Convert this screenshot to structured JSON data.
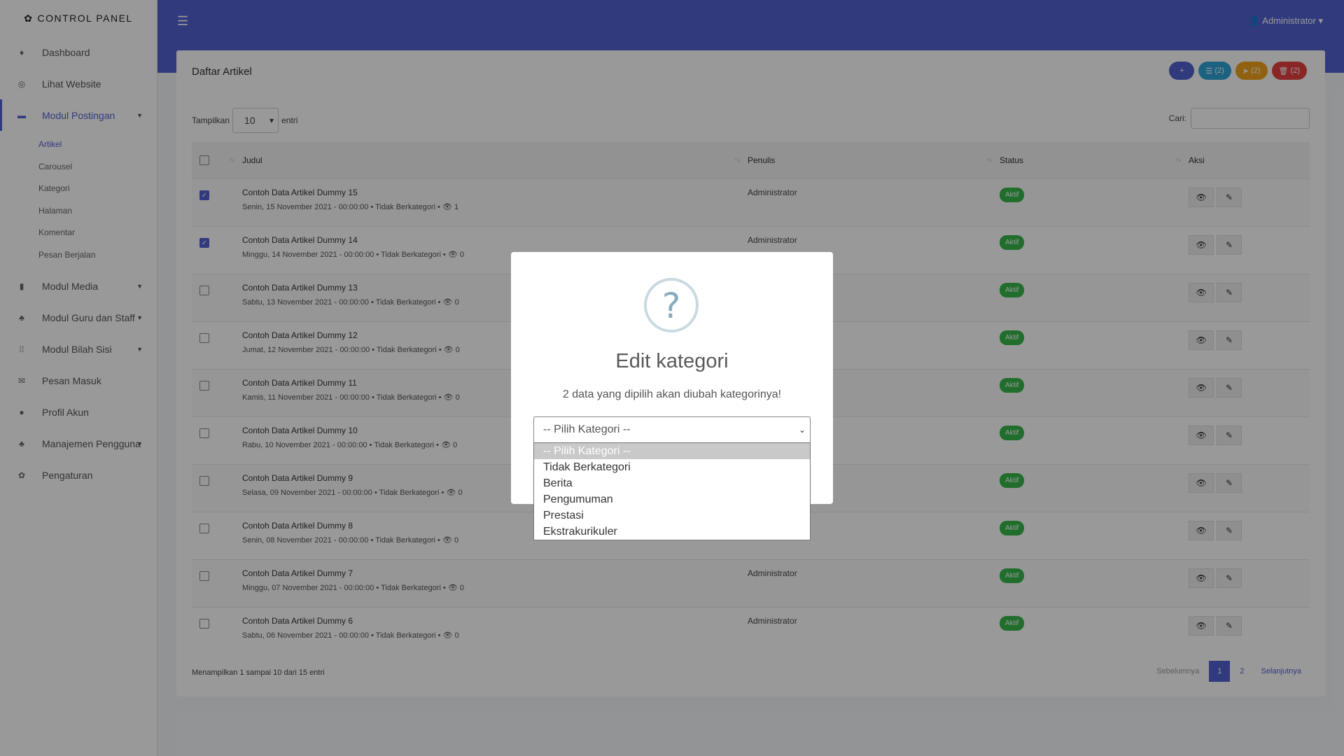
{
  "brand": {
    "icon": "gear-icon",
    "title": "CONTROL PANEL"
  },
  "colors": {
    "primary": "#5261d1",
    "success": "#36b64a",
    "info": "#2fa4d6",
    "warning": "#f0a21a",
    "danger": "#e54141"
  },
  "sidebar": {
    "items": [
      {
        "label": "Dashboard",
        "icon": "fire-icon"
      },
      {
        "label": "Lihat Website",
        "icon": "globe-icon"
      },
      {
        "label": "Modul Postingan",
        "icon": "card-icon"
      },
      {
        "label": "Modul Media",
        "icon": "book-icon"
      },
      {
        "label": "Modul Guru dan Staff",
        "icon": "users-icon"
      },
      {
        "label": "Modul Bilah Sisi",
        "icon": "grid-icon"
      },
      {
        "label": "Pesan Masuk",
        "icon": "mail-icon"
      },
      {
        "label": "Profil Akun",
        "icon": "user-icon"
      },
      {
        "label": "Manajemen Pengguna",
        "icon": "users-icon"
      },
      {
        "label": "Pengaturan",
        "icon": "gear-icon"
      }
    ],
    "submenu": [
      "Artikel",
      "Carousel",
      "Kategori",
      "Halaman",
      "Komentar",
      "Pesan Berjalan"
    ]
  },
  "header": {
    "user": "Administrator"
  },
  "card": {
    "title": "Daftar Artikel",
    "buttons": [
      "+",
      "(2)",
      "(2)",
      "(2)"
    ]
  },
  "length": {
    "prefix": "Tampilkan",
    "value": "10",
    "suffix": "entri"
  },
  "search": {
    "label": "Cari:"
  },
  "table": {
    "headers": [
      "Judul",
      "Penulis",
      "Status",
      "Aksi"
    ],
    "rows": [
      {
        "title": "Contoh Data Artikel Dummy 15",
        "meta": "Senin, 15 November 2021 - 00:00:00 •  Tidak Berkategori •",
        "views": "1",
        "author": "Administrator",
        "status": "Aktif"
      },
      {
        "title": "Contoh Data Artikel Dummy 14",
        "meta": "Minggu, 14 November 2021 - 00:00:00 •  Tidak Berkategori •",
        "views": "0",
        "author": "Administrator",
        "status": "Aktif"
      },
      {
        "title": "Contoh Data Artikel Dummy 13",
        "meta": "Sabtu, 13 November 2021 - 00:00:00 •  Tidak Berkategori •",
        "views": "0",
        "author": "",
        "status": "Aktif"
      },
      {
        "title": "Contoh Data Artikel Dummy 12",
        "meta": "Jumat, 12 November 2021 - 00:00:00 •  Tidak Berkategori •",
        "views": "0",
        "author": "",
        "status": "Aktif"
      },
      {
        "title": "Contoh Data Artikel Dummy 11",
        "meta": "Kamis, 11 November 2021 - 00:00:00 •  Tidak Berkategori •",
        "views": "0",
        "author": "",
        "status": "Aktif"
      },
      {
        "title": "Contoh Data Artikel Dummy 10",
        "meta": "Rabu, 10 November 2021 - 00:00:00 •  Tidak Berkategori •",
        "views": "0",
        "author": "",
        "status": "Aktif"
      },
      {
        "title": "Contoh Data Artikel Dummy 9",
        "meta": "Selasa, 09 November 2021 - 00:00:00 •  Tidak Berkategori •",
        "views": "0",
        "author": "",
        "status": "Aktif"
      },
      {
        "title": "Contoh Data Artikel Dummy 8",
        "meta": "Senin, 08 November 2021 - 00:00:00 •  Tidak Berkategori •",
        "views": "0",
        "author": "",
        "status": "Aktif"
      },
      {
        "title": "Contoh Data Artikel Dummy 7",
        "meta": "Minggu, 07 November 2021 - 00:00:00 •  Tidak Berkategori •",
        "views": "0",
        "author": "Administrator",
        "status": "Aktif"
      },
      {
        "title": "Contoh Data Artikel Dummy 6",
        "meta": "Sabtu, 06 November 2021 - 00:00:00 •  Tidak Berkategori •",
        "views": "0",
        "author": "Administrator",
        "status": "Aktif"
      }
    ]
  },
  "footer": {
    "info": "Menampilkan 1 sampai 10 dari 15 entri",
    "prev": "Sebelumnya",
    "pages": [
      "1",
      "2"
    ],
    "next": "Selanjutnya"
  },
  "modal": {
    "icon": "?",
    "title": "Edit kategori",
    "text": "2 data yang dipilih akan diubah kategorinya!",
    "select_value": "-- Pilih Kategori --",
    "options": [
      "-- Pilih Kategori --",
      "Tidak Berkategori",
      "Berita",
      "Pengumuman",
      "Prestasi",
      "Ekstrakurikuler"
    ]
  }
}
